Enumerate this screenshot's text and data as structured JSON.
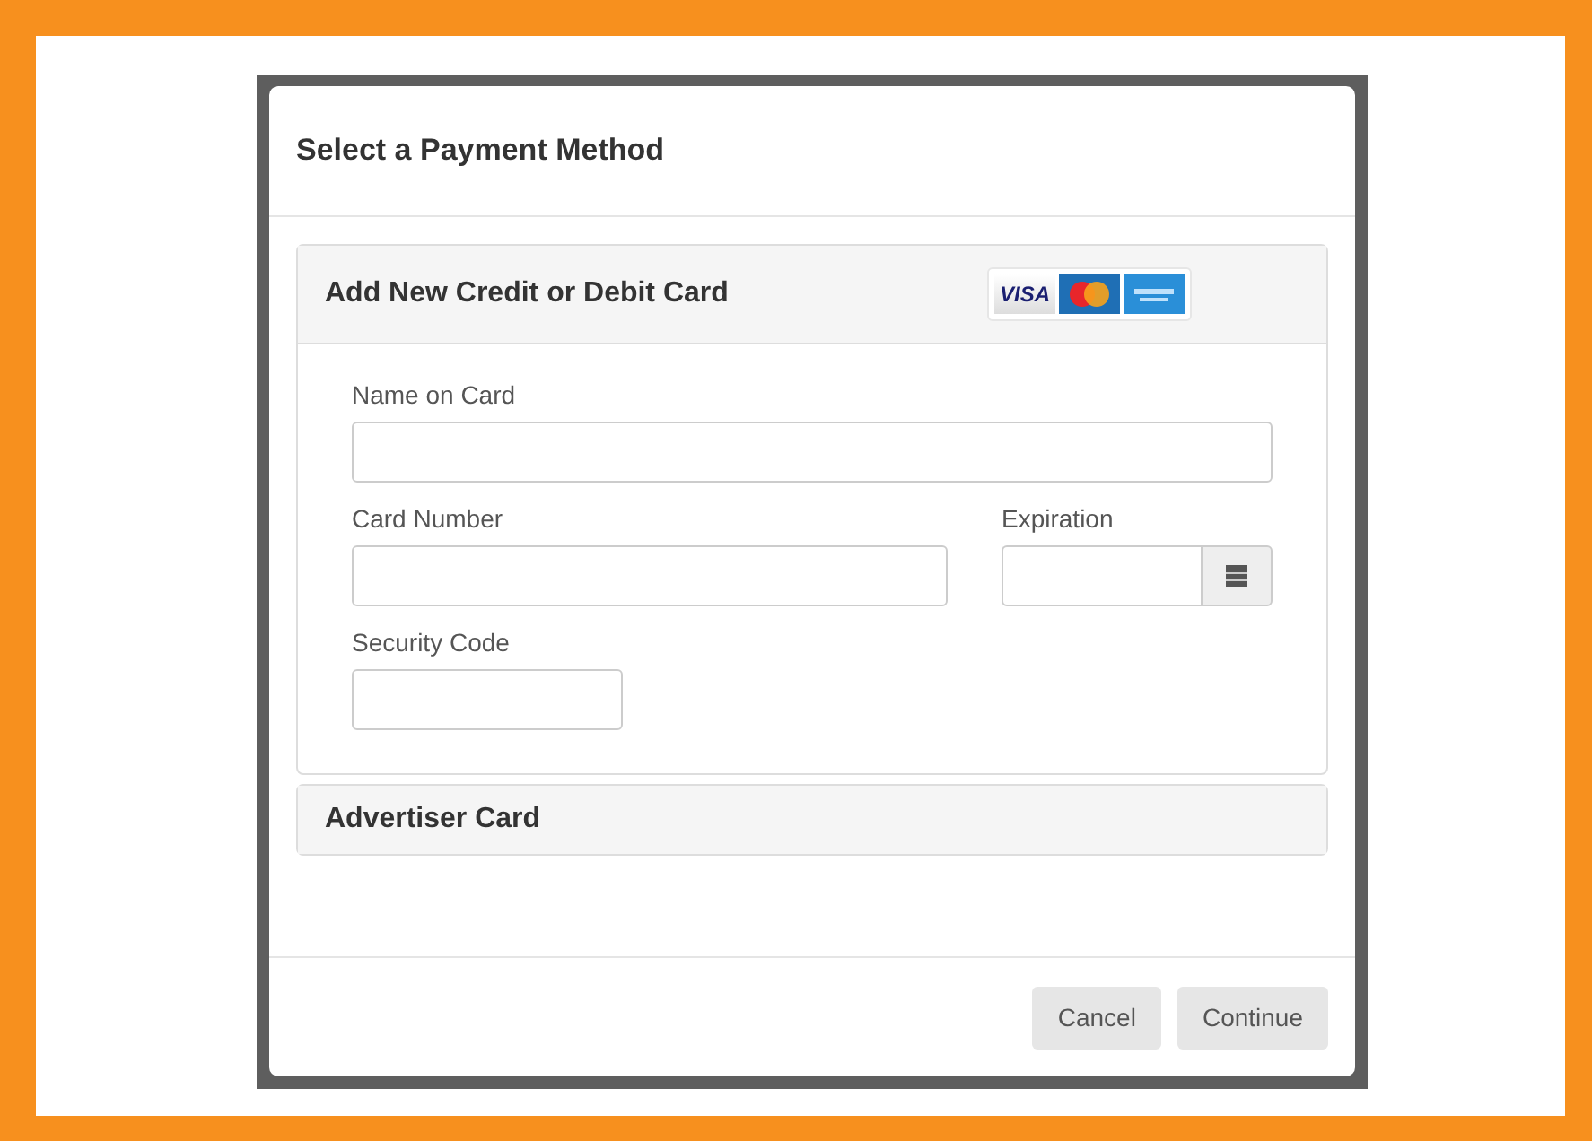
{
  "dialog": {
    "title": "Select a Payment Method"
  },
  "card_panel": {
    "title": "Add New Credit or Debit Card",
    "logo_text": "VISA"
  },
  "fields": {
    "name": {
      "label": "Name on Card"
    },
    "number": {
      "label": "Card Number"
    },
    "expiration": {
      "label": "Expiration"
    },
    "security": {
      "label": "Security Code"
    }
  },
  "advertiser_panel": {
    "title": "Advertiser Card"
  },
  "buttons": [
    {
      "label": "Cancel"
    },
    {
      "label": "Continue"
    }
  ]
}
